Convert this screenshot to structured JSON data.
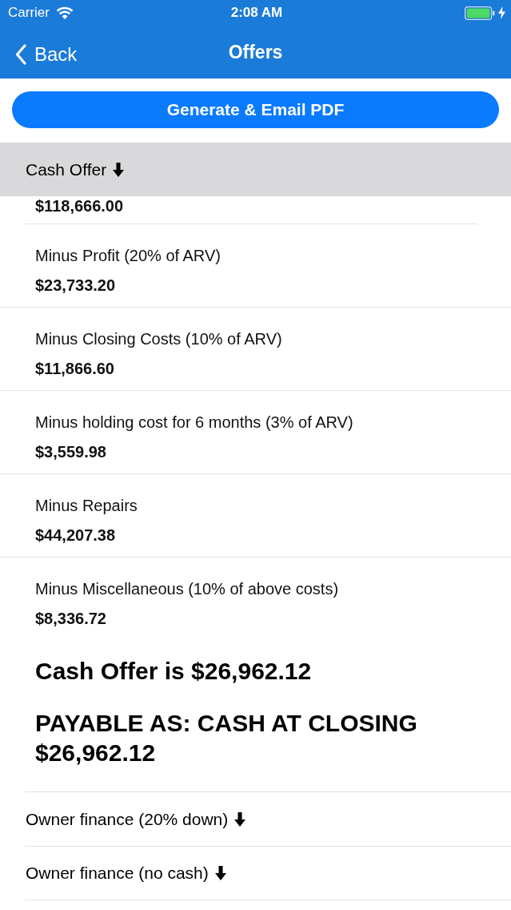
{
  "status_bar": {
    "carrier": "Carrier",
    "time": "2:08 AM",
    "charging": true
  },
  "nav_bar": {
    "back_label": "Back",
    "title": "Offers"
  },
  "primary_button": {
    "label": "Generate & Email PDF"
  },
  "sections": [
    {
      "title": "Cash Offer",
      "pinned": true,
      "rows": [
        {
          "value": "$118,666.00"
        },
        {
          "label": "Minus Profit (20% of ARV)",
          "value": "$23,733.20"
        },
        {
          "label": "Minus Closing Costs (10% of ARV)",
          "value": "$11,866.60"
        },
        {
          "label": "Minus holding cost for 6 months (3% of ARV)",
          "value": "$3,559.98"
        },
        {
          "label": "Minus Repairs",
          "value": "$44,207.38"
        },
        {
          "label": "Minus Miscellaneous (10% of above costs)",
          "value": "$8,336.72"
        }
      ],
      "summary": [
        "Cash Offer is $26,962.12",
        "PAYABLE AS: CASH AT CLOSING $26,962.12"
      ]
    },
    {
      "title": "Owner finance (20% down)",
      "pinned": false
    },
    {
      "title": "Owner finance (no cash)",
      "pinned": false
    }
  ]
}
